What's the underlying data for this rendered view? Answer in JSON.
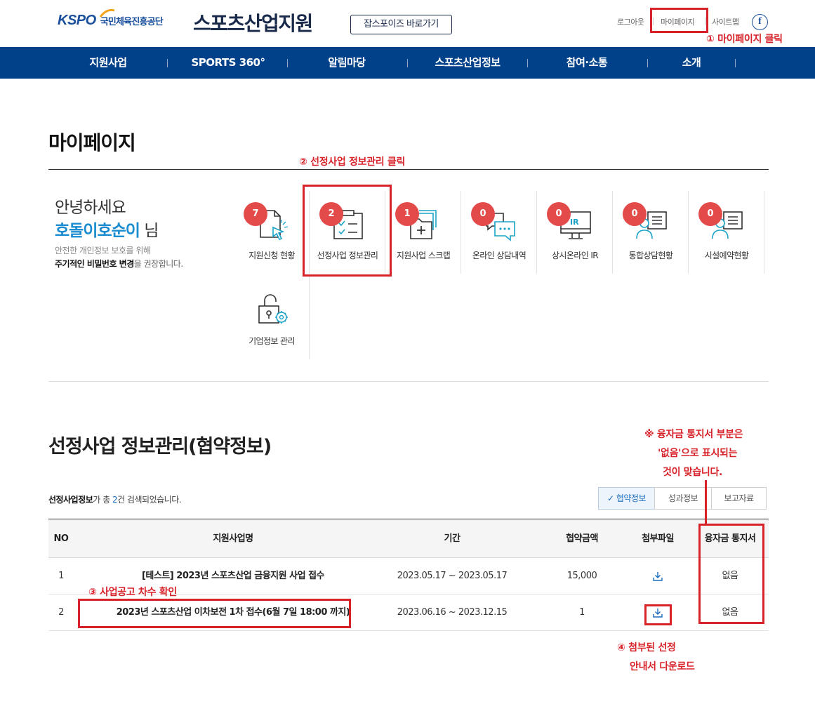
{
  "header": {
    "logo_text": "KSPO",
    "org_name": "국민체육진흥공단",
    "site_title": "스포츠산업지원",
    "jobs_button": "잡스포이즈 바로가기",
    "util": {
      "logout": "로그아웃",
      "mypage": "마이페이지",
      "sitemap": "사이트맵"
    },
    "facebook_glyph": "f"
  },
  "nav": [
    "지원사업",
    "SPORTS 360°",
    "알림마당",
    "스포츠산업정보",
    "참여·소통",
    "소개"
  ],
  "page_title": "마이페이지",
  "greeting": {
    "hello": "안녕하세요",
    "user_name": "호돌이호순이",
    "honorific": " 님",
    "notice_line1": "안전한 개인정보 보호를 위해",
    "notice_bold": "주기적인 비밀번호 변경",
    "notice_rest": "을 권장합니다."
  },
  "menu": [
    {
      "label": "지원신청 현황",
      "count": "7",
      "icon": "document-cursor-icon"
    },
    {
      "label": "선정사업 정보관리",
      "count": "2",
      "icon": "clipboard-check-icon"
    },
    {
      "label": "지원사업 스크랩",
      "count": "1",
      "icon": "folder-plus-icon"
    },
    {
      "label": "온라인 상담내역",
      "count": "0",
      "icon": "chat-bubbles-icon"
    },
    {
      "label": "상시온라인 IR",
      "count": "0",
      "icon": "monitor-ir-icon"
    },
    {
      "label": "통합상담현황",
      "count": "0",
      "icon": "person-board-icon"
    },
    {
      "label": "시설예약현황",
      "count": "0",
      "icon": "person-board-icon"
    },
    {
      "label": "기업정보 관리",
      "icon": "lock-gear-icon"
    }
  ],
  "section_title": "선정사업 정보관리(협약정보)",
  "result": {
    "label": "선정사업정보",
    "prefix": "가 총 ",
    "count": "2",
    "suffix": "건 검색되었습니다."
  },
  "tabs": [
    {
      "label": "협약정보",
      "active": true
    },
    {
      "label": "성과정보",
      "active": false
    },
    {
      "label": "보고자료",
      "active": false
    }
  ],
  "table": {
    "headers": [
      "NO",
      "지원사업명",
      "기간",
      "협약금액",
      "첨부파일",
      "융자금 통지서"
    ],
    "rows": [
      {
        "no": "1",
        "name": "[테스트] 2023년 스포츠산업 금융지원 사업 접수",
        "period": "2023.05.17 ~ 2023.05.17",
        "amount": "15,000",
        "notice": "없음"
      },
      {
        "no": "2",
        "name": "2023년 스포츠산업 이차보전 1차 접수(6월 7일 18:00 까지)",
        "period": "2023.06.16 ~ 2023.12.15",
        "amount": "1",
        "notice": "없음"
      }
    ]
  },
  "annotations": {
    "step1": "① 마이페이지 클릭",
    "step2": "② 선정사업 정보관리 클릭",
    "step3": "③  사업공고 차수 확인",
    "step4_line1": "④ 첨부된 선정",
    "step4_line2": "안내서 다운로드",
    "note_line1": "※ 융자금 통지서 부분은",
    "note_line2": "'없음'으로 표시되는",
    "note_line3": "것이 맞습니다."
  },
  "colors": {
    "nav": "#00418a",
    "accent": "#1b8ccf",
    "badge": "#e34b4b",
    "annotation": "#d8222a"
  }
}
